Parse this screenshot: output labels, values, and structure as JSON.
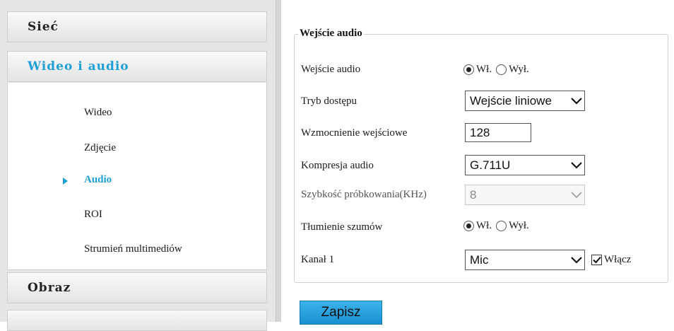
{
  "sidebar": {
    "sections": {
      "network": "Sieć",
      "video_audio": "Wideo i audio",
      "image": "Obraz"
    },
    "submenu": [
      {
        "label": "Wideo"
      },
      {
        "label": "Zdjęcie"
      },
      {
        "label": "Audio",
        "active": true
      },
      {
        "label": "ROI"
      },
      {
        "label": "Strumień multimediów"
      }
    ]
  },
  "form": {
    "legend": "Wejście audio",
    "audio_input": {
      "label": "Wejście audio",
      "on": "Wł.",
      "off": "Wył.",
      "selected": "Wł."
    },
    "access_mode": {
      "label": "Tryb dostępu",
      "value": "Wejście liniowe"
    },
    "input_gain": {
      "label": "Wzmocnienie wejściowe",
      "value": "128"
    },
    "audio_compression": {
      "label": "Kompresja audio",
      "value": "G.711U"
    },
    "sampling_rate": {
      "label": "Szybkość próbkowania(KHz)",
      "value": "8",
      "disabled": true
    },
    "noise_suppression": {
      "label": "Tłumienie szumów",
      "on": "Wł.",
      "off": "Wył.",
      "selected": "Wł."
    },
    "channel1": {
      "label": "Kanał 1",
      "value": "Mic",
      "enable_label": "Włącz",
      "enabled": true
    },
    "save_label": "Zapisz"
  },
  "colors": {
    "accent": "#1f9fd7",
    "save_button": "#2aa6e2"
  },
  "icons": {
    "arrow": "play-arrow-icon",
    "chevron": "chevron-down-icon",
    "check": "check-icon"
  }
}
